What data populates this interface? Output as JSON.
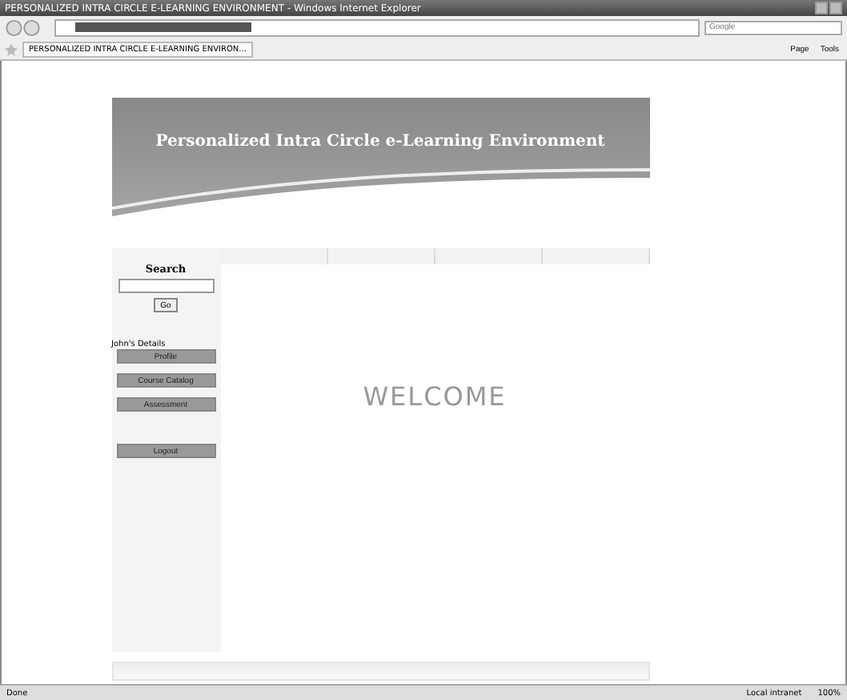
{
  "window": {
    "title": "PERSONALIZED INTRA CIRCLE E-LEARNING ENVIRONMENT - Windows Internet Explorer"
  },
  "browser": {
    "search_placeholder": "Google",
    "tab_label": "PERSONALIZED INTRA CIRCLE E-LEARNING ENVIRON...",
    "toolbar_items": [
      "Page",
      "Tools"
    ]
  },
  "page": {
    "banner_title": "Personalized Intra Circle e-Learning Environment",
    "nav_tabs": [
      {
        "selected": false
      },
      {
        "selected": false
      },
      {
        "selected": false
      },
      {
        "selected": false
      }
    ],
    "search": {
      "heading": "Search",
      "button": "Go"
    },
    "user_label": "John's Details",
    "menu": [
      {
        "label": "Profile",
        "kind": "button"
      },
      {
        "label": "Course Catalog",
        "kind": "button"
      },
      {
        "label": "Assessment",
        "kind": "button"
      },
      {
        "label": "Logout",
        "kind": "gap-button"
      }
    ],
    "welcome": "WELCOME"
  },
  "status_bar": {
    "status": "Done",
    "zone": "Local intranet",
    "zoom": "100%"
  }
}
